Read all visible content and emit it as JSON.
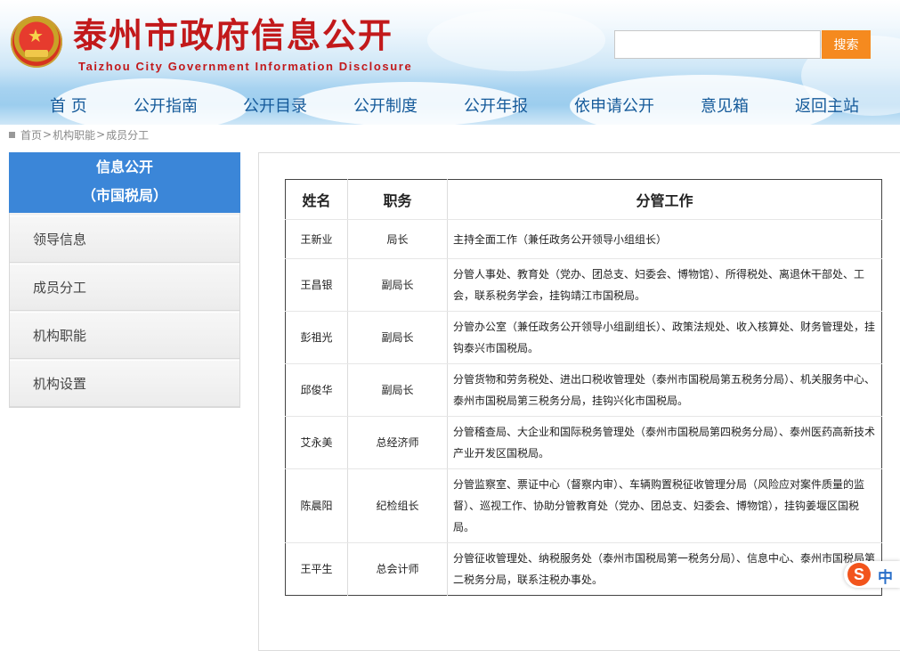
{
  "header": {
    "title": "泰州市政府信息公开",
    "subtitle": "Taizhou City Government Information Disclosure",
    "search": {
      "button_label": "搜索",
      "value": ""
    }
  },
  "nav": [
    "首 页",
    "公开指南",
    "公开目录",
    "公开制度",
    "公开年报",
    "依申请公开",
    "意见箱",
    "返回主站"
  ],
  "breadcrumb": [
    "首页",
    "机构职能",
    "成员分工"
  ],
  "sidebar": {
    "title_line1": "信息公开",
    "title_line2": "（市国税局）",
    "items": [
      "领导信息",
      "成员分工",
      "机构职能",
      "机构设置"
    ]
  },
  "table": {
    "headers": [
      "姓名",
      "职务",
      "分管工作"
    ],
    "rows": [
      {
        "name": "王新业",
        "title": "局长",
        "duty": "主持全面工作（兼任政务公开领导小组组长）"
      },
      {
        "name": "王昌银",
        "title": "副局长",
        "duty": "分管人事处、教育处（党办、团总支、妇委会、博物馆）、所得税处、离退休干部处、工会，联系税务学会，挂钩靖江市国税局。"
      },
      {
        "name": "彭祖光",
        "title": "副局长",
        "duty": "分管办公室（兼任政务公开领导小组副组长）、政策法规处、收入核算处、财务管理处，挂钩泰兴市国税局。"
      },
      {
        "name": "邱俊华",
        "title": "副局长",
        "duty": "分管货物和劳务税处、进出口税收管理处（泰州市国税局第五税务分局）、机关服务中心、泰州市国税局第三税务分局，挂钩兴化市国税局。"
      },
      {
        "name": "艾永美",
        "title": "总经济师",
        "duty": "分管稽查局、大企业和国际税务管理处（泰州市国税局第四税务分局）、泰州医药高新技术产业开发区国税局。"
      },
      {
        "name": "陈晨阳",
        "title": "纪检组长",
        "duty": "分管监察室、票证中心（督察内审）、车辆购置税征收管理分局（风险应对案件质量的监督）、巡视工作、协助分管教育处（党办、团总支、妇委会、博物馆），挂钩姜堰区国税局。"
      },
      {
        "name": "王平生",
        "title": "总会计师",
        "duty": "分管征收管理处、纳税服务处（泰州市国税局第一税务分局）、信息中心、泰州市国税局第二税务分局，联系注税办事处。"
      }
    ]
  },
  "ime": {
    "logo": "S",
    "mode": "中"
  }
}
